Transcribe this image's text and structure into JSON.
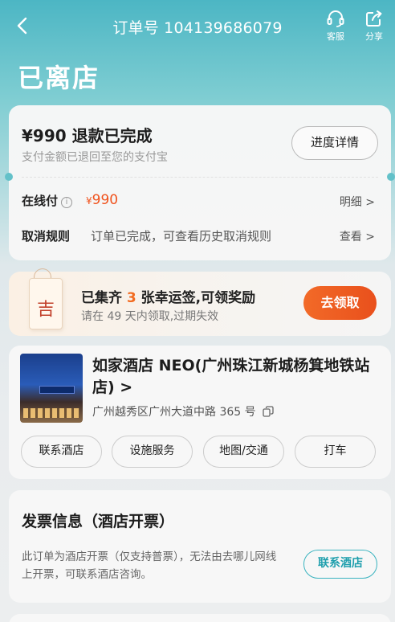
{
  "header": {
    "order_number": "订单号 104139686079",
    "service_label": "客服",
    "share_label": "分享",
    "status_title": "已离店"
  },
  "refund": {
    "title": "¥990 退款已完成",
    "subtitle": "支付金额已退回至您的支付宝",
    "progress_button": "进度详情",
    "online_pay_label": "在线付",
    "info_mark": "i",
    "currency_symbol": "¥",
    "amount": "990",
    "detail_link": "明细 >",
    "cancel_rule_label": "取消规则",
    "cancel_rule_text": "订单已完成，可查看历史取消规则",
    "view_link": "查看 >"
  },
  "lucky": {
    "tag_char": "吉",
    "title_prefix": "已集齐 ",
    "count": "3",
    "title_suffix": " 张幸运签,可领奖励",
    "subtitle": "请在 49 天内领取,过期失效",
    "claim_button": "去领取"
  },
  "hotel": {
    "name": "如家酒店 NEO(广州珠江新城杨箕地铁站店) >",
    "address": "广州越秀区广州大道中路 365 号",
    "actions": [
      "联系酒店",
      "设施服务",
      "地图/交通",
      "打车"
    ]
  },
  "invoice": {
    "title": "发票信息（酒店开票）",
    "text": "此订单为酒店开票（仅支持普票），无法由去哪儿网线上开票，可联系酒店咨询。",
    "contact_button": "联系酒店"
  },
  "colors": {
    "accent_orange": "#f26a28",
    "price_orange": "#f0521c",
    "teal": "#1f9fad"
  }
}
